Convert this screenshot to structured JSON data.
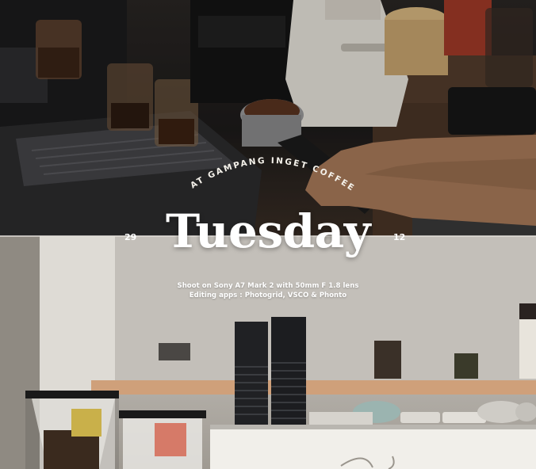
{
  "overlay": {
    "venue_arc_text": "AT GAMPANG INGET COFFEE",
    "day_title": "Tuesday",
    "number_left": "29",
    "number_right": "12",
    "caption_line_1": "Shoot on Sony A7 Mark 2 with 50mm F 1.8 lens",
    "caption_line_2": "Editing apps : Photogrid, VSCO & Phonto"
  },
  "photos": {
    "top": {
      "subject": "espresso-machine-and-grinder"
    },
    "bottom": {
      "subject": "coffee-bar-counter-with-cup-stacks"
    }
  },
  "colors": {
    "text": "#ffffff",
    "top_photo_tone": "#2a2624",
    "bottom_photo_tone": "#c9c6c0"
  }
}
